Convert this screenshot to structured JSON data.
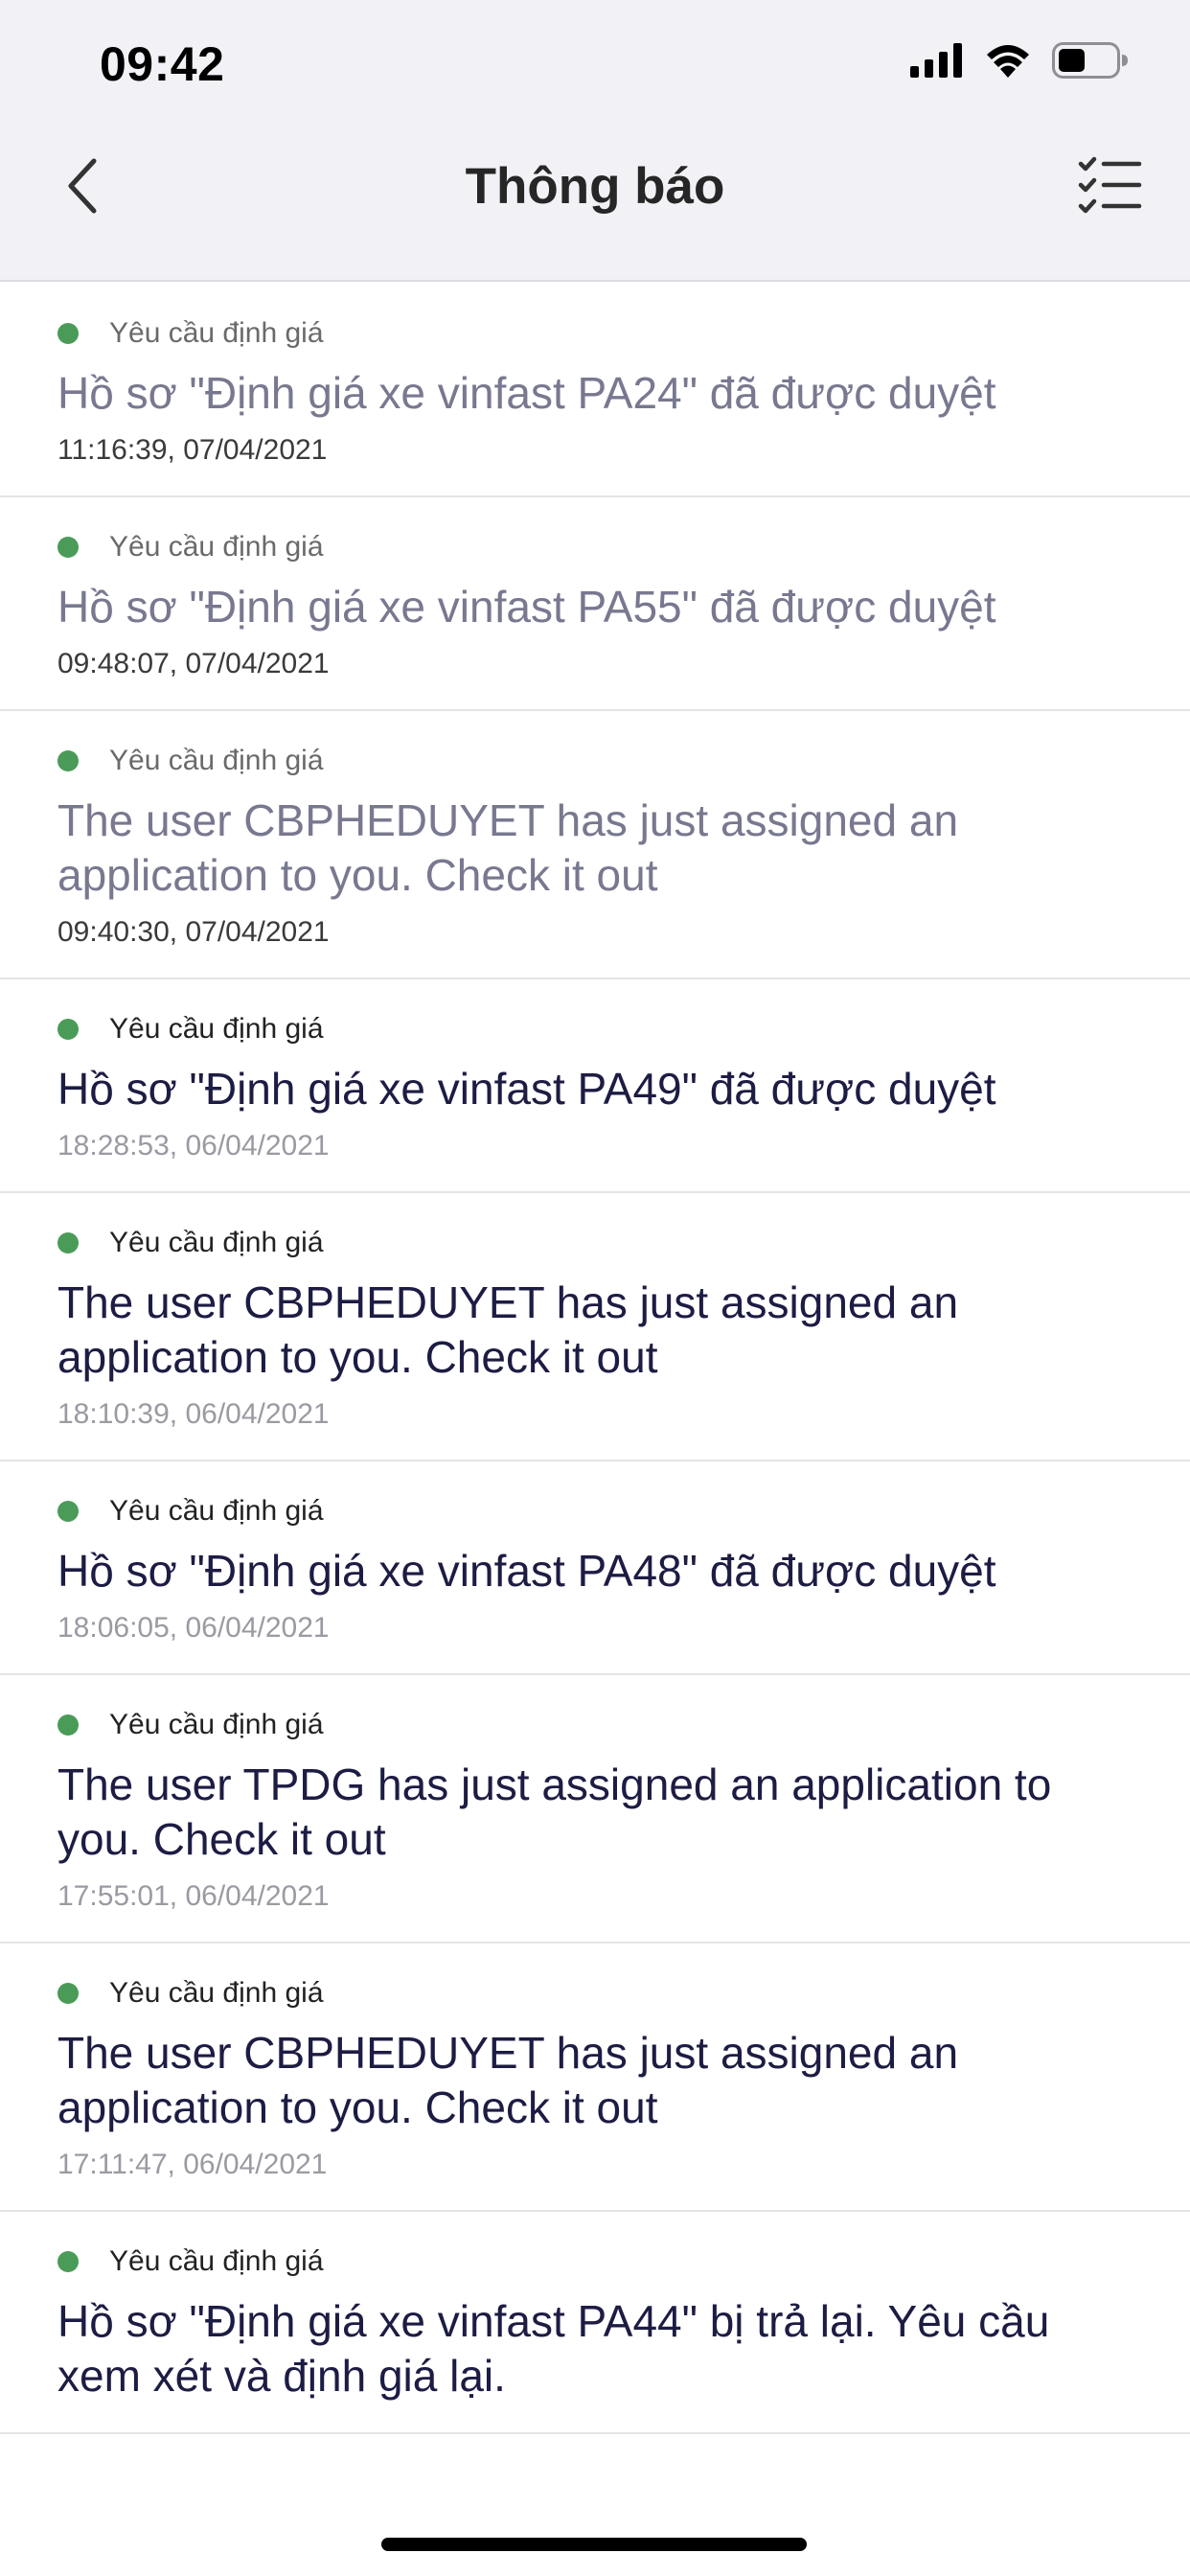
{
  "status_bar": {
    "time": "09:42",
    "icons": [
      "signal-icon",
      "wifi-icon",
      "battery-icon"
    ]
  },
  "header": {
    "title": "Thông báo",
    "back_icon": "chevron-left-icon",
    "mark_all_icon": "checklist-icon"
  },
  "colors": {
    "unread_dot": "#4a9b57",
    "unread_title": "#1c1c44",
    "read_title": "#787890",
    "header_bg": "#f2f2f6"
  },
  "notifications": [
    {
      "category": "Yêu cầu định giá",
      "title": "Hồ sơ \"Định giá xe vinfast PA24\" đã được duyệt",
      "time": "11:16:39, 07/04/2021",
      "read": true
    },
    {
      "category": "Yêu cầu định giá",
      "title": "Hồ sơ \"Định giá xe vinfast PA55\" đã được duyệt",
      "time": "09:48:07, 07/04/2021",
      "read": true
    },
    {
      "category": "Yêu cầu định giá",
      "title": "The user CBPHEDUYET has just assigned an application to you. Check it out",
      "time": "09:40:30, 07/04/2021",
      "read": true
    },
    {
      "category": "Yêu cầu định giá",
      "title": "Hồ sơ \"Định giá xe vinfast PA49\" đã được duyệt",
      "time": "18:28:53, 06/04/2021",
      "read": false
    },
    {
      "category": "Yêu cầu định giá",
      "title": "The user CBPHEDUYET has just assigned an application to you. Check it out",
      "time": "18:10:39, 06/04/2021",
      "read": false
    },
    {
      "category": "Yêu cầu định giá",
      "title": "Hồ sơ \"Định giá xe vinfast PA48\" đã được duyệt",
      "time": "18:06:05, 06/04/2021",
      "read": false
    },
    {
      "category": "Yêu cầu định giá",
      "title": "The user TPDG has just assigned an application to you. Check it out",
      "time": "17:55:01, 06/04/2021",
      "read": false
    },
    {
      "category": "Yêu cầu định giá",
      "title": "The user CBPHEDUYET has just assigned an application to you. Check it out",
      "time": "17:11:47, 06/04/2021",
      "read": false
    },
    {
      "category": "Yêu cầu định giá",
      "title": "Hồ sơ \"Định giá xe vinfast PA44\" bị trả lại. Yêu cầu xem xét và định giá lại.",
      "time": "",
      "read": false
    }
  ]
}
